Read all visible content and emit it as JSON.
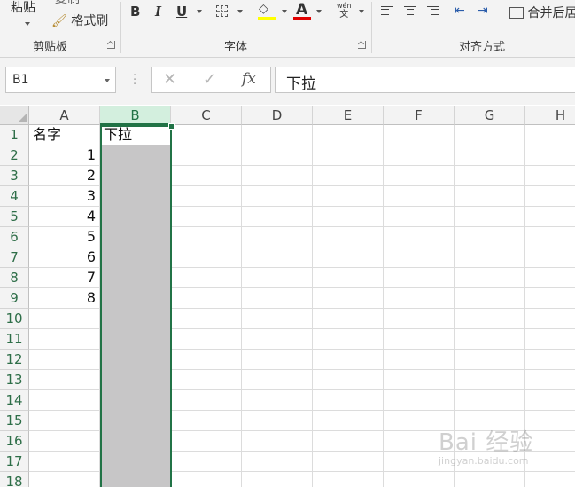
{
  "ribbon": {
    "clipboard": {
      "paste_label": "粘贴",
      "copy_label": "复制",
      "format_painter_label": "格式刷",
      "group_label": "剪贴板"
    },
    "font": {
      "bold": "B",
      "italic": "I",
      "underline": "U",
      "font_color_glyph": "A",
      "phonetic_top": "wén",
      "phonetic_bottom": "文",
      "group_label": "字体",
      "highlight_color": "#ffff00",
      "font_color": "#e00000"
    },
    "alignment": {
      "merge_label": "合并后居",
      "group_label": "对齐方式"
    }
  },
  "formula_bar": {
    "name_box": "B1",
    "cancel_glyph": "✕",
    "enter_glyph": "✓",
    "fx_glyph": "fx",
    "formula": "下拉"
  },
  "grid": {
    "columns": [
      "A",
      "B",
      "C",
      "D",
      "E",
      "F",
      "G",
      "H"
    ],
    "rows": [
      "1",
      "2",
      "3",
      "4",
      "5",
      "6",
      "7",
      "8",
      "9",
      "10",
      "11",
      "12",
      "13",
      "14",
      "15",
      "16",
      "17",
      "18"
    ],
    "colA": [
      "名字",
      "1",
      "2",
      "3",
      "4",
      "5",
      "6",
      "7",
      "8",
      "",
      "",
      "",
      "",
      "",
      "",
      "",
      "",
      ""
    ],
    "colB": [
      "下拉",
      "",
      "",
      "",
      "",
      "",
      "",
      "",
      "",
      "",
      "",
      "",
      "",
      "",
      "",
      "",
      "",
      ""
    ],
    "selected_column": "B",
    "accent": "#217346"
  },
  "watermark": {
    "main": "Bai 经验",
    "sub": "jingyan.baidu.com"
  }
}
